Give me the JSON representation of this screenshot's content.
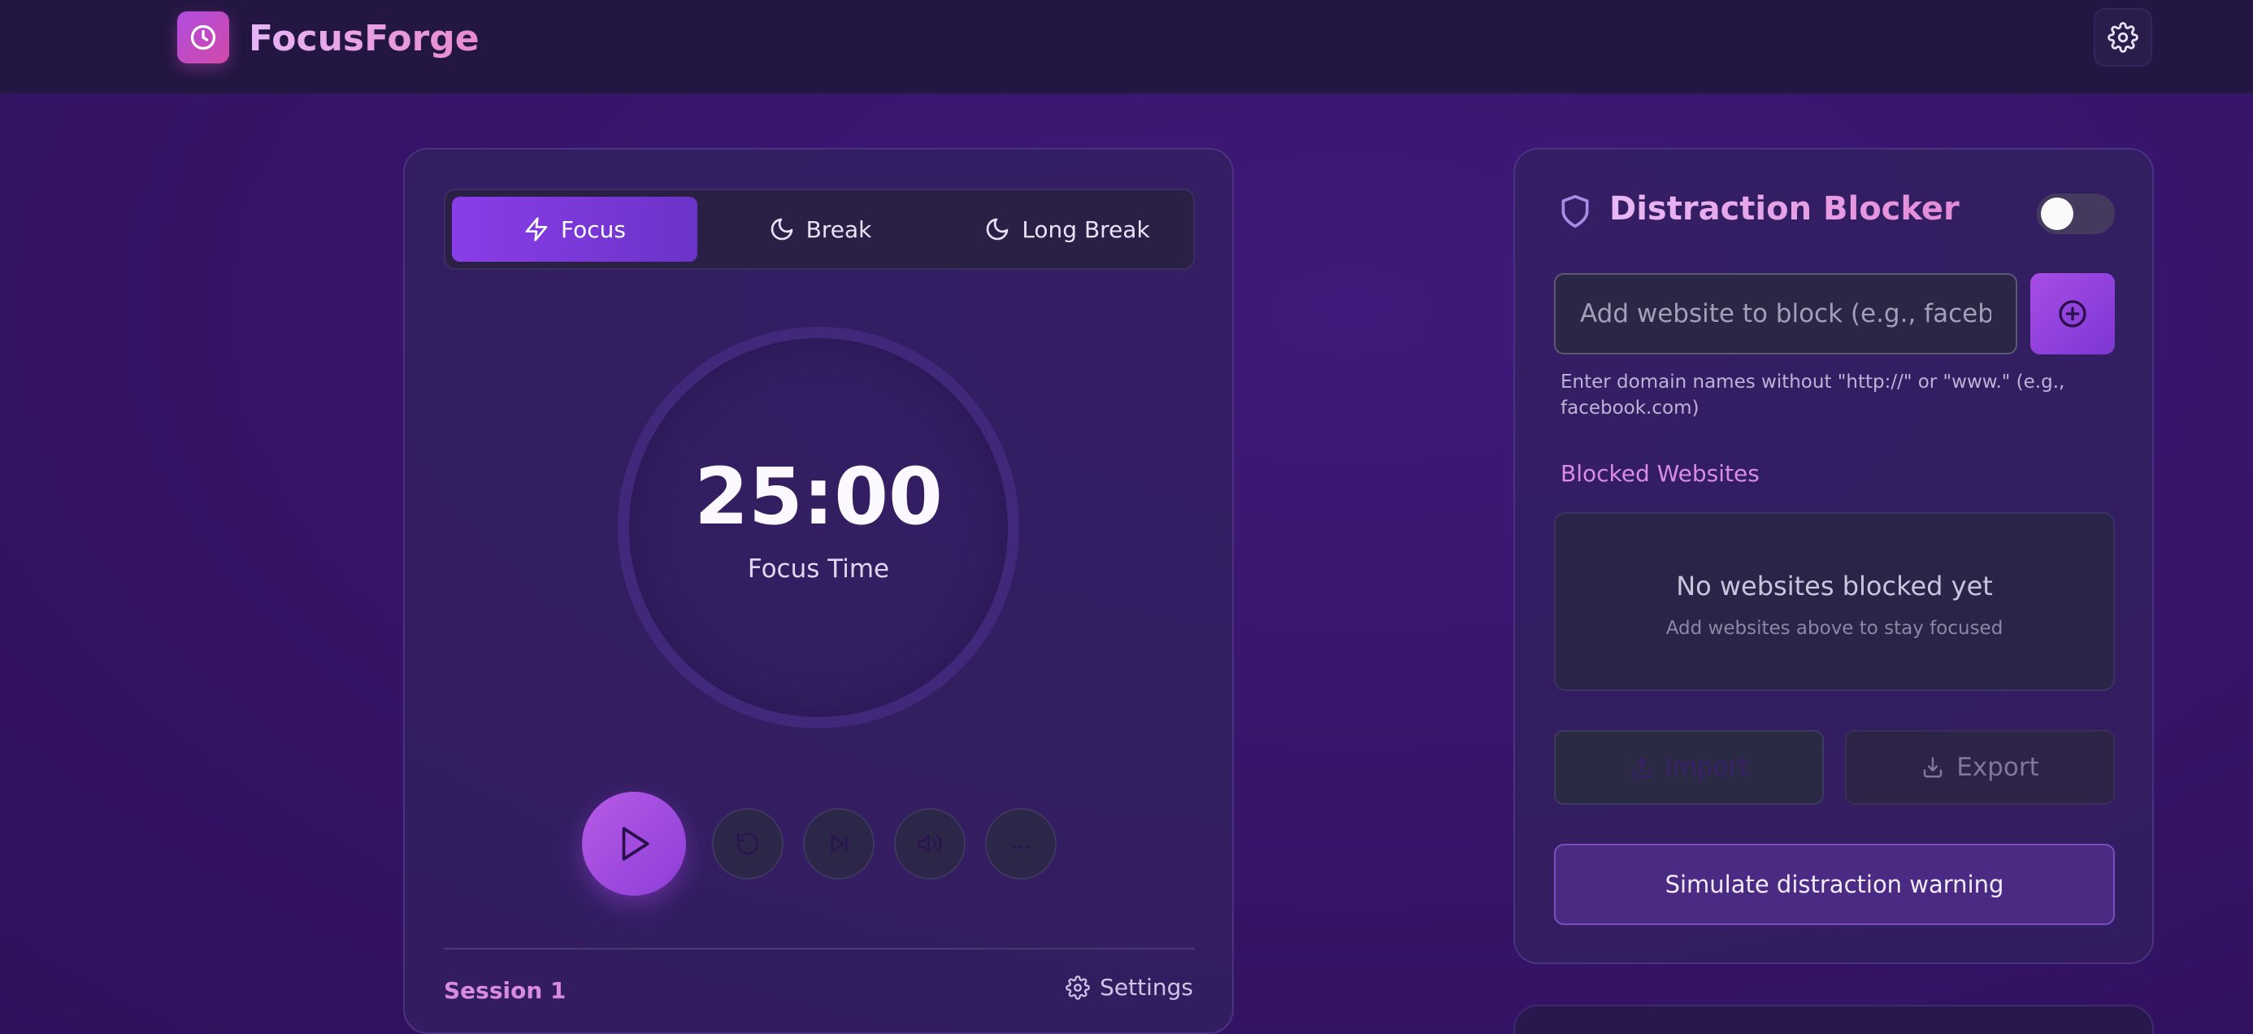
{
  "app": {
    "title": "FocusForge",
    "logo_icon": "clock-icon",
    "settings_icon": "gear-icon"
  },
  "timer": {
    "tabs": [
      {
        "label": "Focus",
        "icon": "lightning-icon",
        "active": true
      },
      {
        "label": "Break",
        "icon": "moon-icon",
        "active": false
      },
      {
        "label": "Long Break",
        "icon": "moon-icon",
        "active": false
      }
    ],
    "time": "25:00",
    "mode_label": "Focus Time",
    "session_label": "Session 1",
    "settings_label": "Settings"
  },
  "blocker": {
    "title": "Distraction Blocker",
    "enabled": false,
    "input_placeholder": "Add website to block (e.g., facebook.com)",
    "hint": "Enter domain names without \"http://\" or \"www.\" (e.g., facebook.com)",
    "blocked_label": "Blocked Websites",
    "empty_title": "No websites blocked yet",
    "empty_sub": "Add websites above to stay focused",
    "import_label": "Import",
    "export_label": "Export",
    "simulate_label": "Simulate distraction warning"
  },
  "colors": {
    "accent": "#8a3de8",
    "brand_pink": "#e48ad6",
    "background": "#361468"
  }
}
